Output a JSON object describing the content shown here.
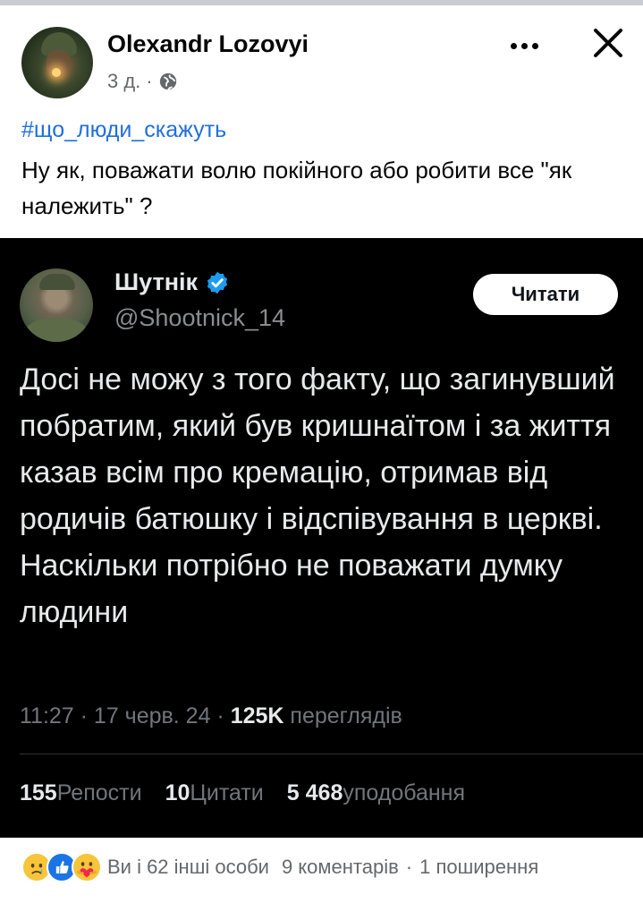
{
  "post": {
    "author": "Olexandr Lozovyi",
    "time": "3 д.",
    "meta_separator": "·",
    "hashtag": "#що_люди_скажуть",
    "text": "Ну як, поважати волю покійного або робити все \"як належить\" ?"
  },
  "tweet": {
    "name": "Шутнік",
    "handle": "@Shootnick_14",
    "follow_label": "Читати",
    "text": "Досі не можу з того факту, що загинувший побратим, який був кришнаїтом і за життя казав всім про кремацію, отримав від родичів батюшку і відспівування в церкві. Наскільки потрібно не поважати думку людини",
    "timestamp": "11:27 · 17 черв. 24 · ",
    "views_count": "125K",
    "views_label": " переглядів",
    "reposts_count": "155",
    "reposts_label": " Репости",
    "quotes_count": "10",
    "quotes_label": " Цитати",
    "likes_count": "5 468",
    "likes_label": " уподобання"
  },
  "footer": {
    "reactions_text": "Ви і 62 інші особи",
    "comments": "9 коментарів",
    "separator": "·",
    "shares": "1 поширення",
    "reaction_icons": [
      "sad-emoji",
      "like-emoji",
      "care-emoji"
    ]
  },
  "colors": {
    "hashtag": "#216fdb",
    "verified": "#1d9bf0",
    "tweet_bg": "#000000",
    "secondary_text": "#65676b"
  }
}
